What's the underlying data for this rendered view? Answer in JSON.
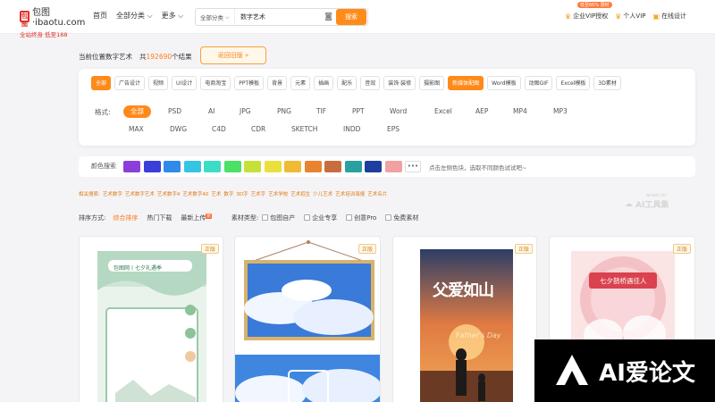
{
  "nav": {
    "logo_text": "包图·ibaotu.com",
    "logo_sub": "全站终身 低至188",
    "links": [
      "首页",
      "全部分类",
      "更多"
    ],
    "search_category": "全部分类",
    "search_value": "数字艺术",
    "search_button": "搜索",
    "vip_badge": "低至66% 限时",
    "right_items": [
      "企业VIP授权",
      "个人VIP",
      "在线设计"
    ]
  },
  "results": {
    "prefix": "当前位置数字艺术",
    "count_prefix": "共",
    "count": "192690",
    "count_suffix": "个结果",
    "old_version_button": "返回旧版 »"
  },
  "categories": [
    "全部",
    "广告设计",
    "视频",
    "UI设计",
    "电商淘宝",
    "PPT模板",
    "背景",
    "元素",
    "插画",
    "配乐",
    "音效",
    "装饰·装修",
    "摄影图",
    "新媒体配图",
    "Word模板",
    "动图GIF",
    "Excel模板",
    "3D素材"
  ],
  "formats": {
    "label": "格式:",
    "row1": [
      "全部",
      "PSD",
      "AI",
      "JPG",
      "PNG",
      "TIF",
      "PPT",
      "Word",
      "Excel",
      "AEP",
      "MP4",
      "MP3"
    ],
    "row2": [
      "MAX",
      "DWG",
      "C4D",
      "CDR",
      "SKETCH",
      "INDD",
      "EPS"
    ]
  },
  "colors": {
    "label": "颜色搜索",
    "swatches": [
      "#8b3fd8",
      "#3b3ed8",
      "#2f8ae8",
      "#35c4e6",
      "#3ddcc4",
      "#4ce065",
      "#c6e03a",
      "#ebdf3c",
      "#f1ba35",
      "#e8842f",
      "#c96d3f",
      "#2aa0a0",
      "#1e3f9c",
      "#f2a0a0"
    ],
    "more": "•••",
    "hint": "点击左侧色块，选取不同颜色试试吧~"
  },
  "related": {
    "label": "相关搜索:",
    "terms": [
      "艺术数字",
      "艺术数字艺术",
      "艺术数字4",
      "艺术数字40",
      "艺术",
      "数字",
      "3D字",
      "艺术字",
      "艺术学校",
      "艺术招生",
      "少儿艺术",
      "艺术培训海报",
      "艺术名片"
    ]
  },
  "watermark_small": {
    "line1": "ai-bot.cn",
    "line2": "AI工具集"
  },
  "sort": {
    "label": "排序方式:",
    "options": [
      "综合排序",
      "热门下载",
      "最新上传"
    ],
    "new_badge": "新",
    "material_label": "素材类型:",
    "material_types": [
      "包图自产",
      "企业专享",
      "创意Pro",
      "免费素材"
    ]
  },
  "cards": [
    {
      "tag": "正版",
      "title": "包图网丨七夕礼遇季"
    },
    {
      "tag": "正版"
    },
    {
      "tag": "正版",
      "headline": "父爱如山",
      "subtitle": "Father's Day"
    },
    {
      "tag": "正版",
      "title": "七夕鹊桥遇佳人"
    }
  ],
  "watermark_big": {
    "text": "AI爱论文"
  }
}
